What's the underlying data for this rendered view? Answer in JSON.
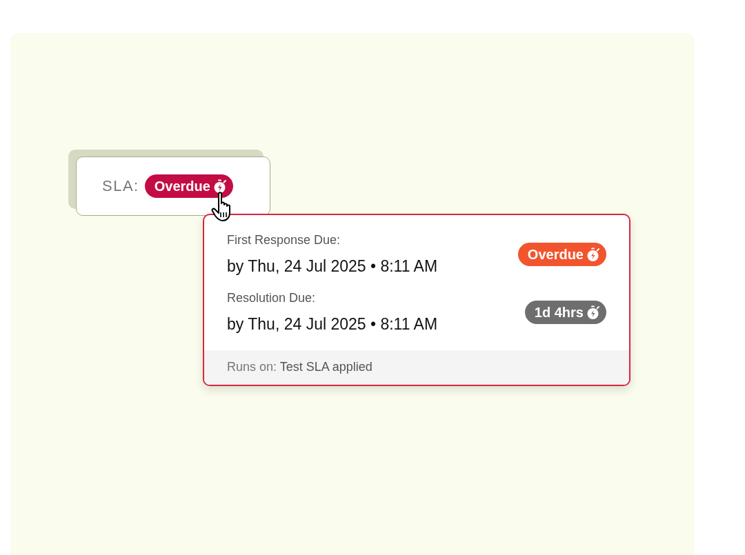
{
  "sla": {
    "label": "SLA:",
    "badge": {
      "text": "Overdue",
      "color": "#c40c44"
    }
  },
  "popover": {
    "items": [
      {
        "label": "First Response Due:",
        "due": "by Thu, 24 Jul 2025 • 8:11 AM",
        "badge": {
          "text": "Overdue",
          "color": "#f2542d"
        }
      },
      {
        "label": "Resolution Due:",
        "due": "by Thu, 24 Jul 2025 • 8:11 AM",
        "badge": {
          "text": "1d 4hrs",
          "color": "#6e6e6e"
        }
      }
    ],
    "footer": {
      "label": "Runs on:",
      "value": "Test SLA applied"
    }
  }
}
